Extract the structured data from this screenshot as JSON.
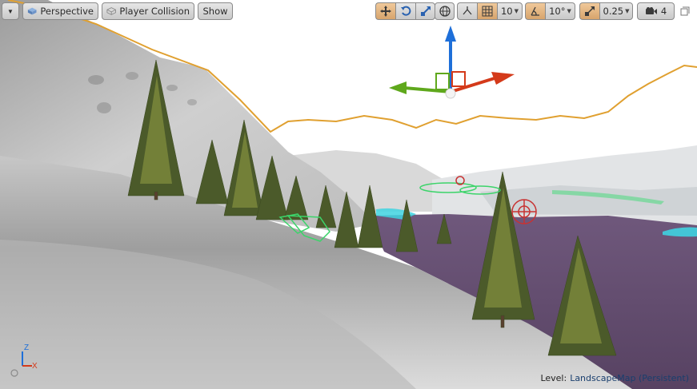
{
  "toolbar": {
    "view_mode": "Perspective",
    "collision_mode": "Player Collision",
    "show_label": "Show",
    "grid_snap_value": "10",
    "rotation_snap_value": "10°",
    "scale_snap_value": "0.25",
    "camera_speed_value": "4"
  },
  "status": {
    "level_label": "Level:",
    "level_name": "LandscapeMap (Persistent)"
  },
  "axis_indicator": {
    "z_label": "Z",
    "x_label": "X"
  },
  "colors": {
    "selection_outline": "#e0a030",
    "gizmo_x": "#d43a1a",
    "gizmo_y": "#5fa81c",
    "gizmo_z": "#1e6fd9",
    "water": "#614a6e",
    "snap_active": "#d7a46c"
  },
  "icons": {
    "viewport_menu": "chevron-down-icon",
    "perspective": "perspective-cube-icon",
    "collision": "wireframe-cube-icon",
    "translate": "move-arrows-icon",
    "rotate": "rotate-icon",
    "scale": "scale-icon",
    "world_local": "globe-icon",
    "surface_snap": "surface-snap-icon",
    "grid": "grid-icon",
    "angle": "angle-icon",
    "scale_snap": "scale-snap-icon",
    "camera_speed": "camera-icon",
    "maximize": "maximize-icon"
  }
}
